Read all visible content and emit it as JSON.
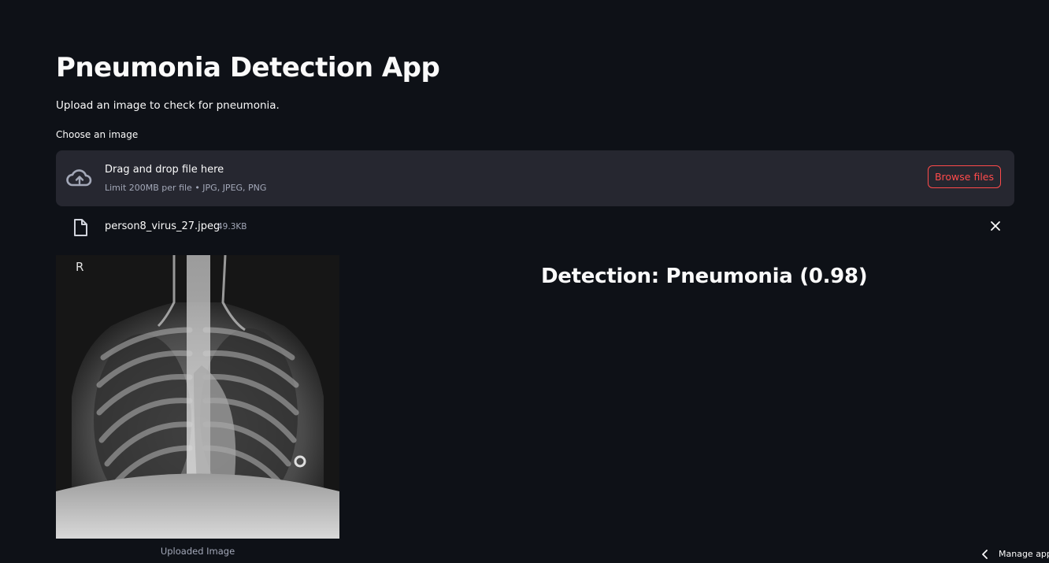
{
  "app": {
    "title": "Pneumonia Detection App",
    "subtitle": "Upload an image to check for pneumonia."
  },
  "uploader": {
    "label": "Choose an image",
    "drop_title": "Drag and drop file here",
    "drop_limit": "Limit 200MB per file • JPG, JPEG, PNG",
    "browse_label": "Browse files",
    "icon": "cloud-upload-icon"
  },
  "uploaded_file": {
    "name": "person8_virus_27.jpeg",
    "size": "49.3KB",
    "icon": "file-icon",
    "remove_icon": "close-icon"
  },
  "image": {
    "caption": "Uploaded Image",
    "marker": "R"
  },
  "result": {
    "text": "Detection: Pneumonia (0.98)"
  },
  "footer": {
    "manage_label": "Manage app",
    "icon": "chevron-left-icon"
  },
  "colors": {
    "background": "#0e1117",
    "surface": "#262730",
    "accent": "#ff4b4b",
    "text": "#fafafa",
    "muted": "#a3a8b8"
  }
}
